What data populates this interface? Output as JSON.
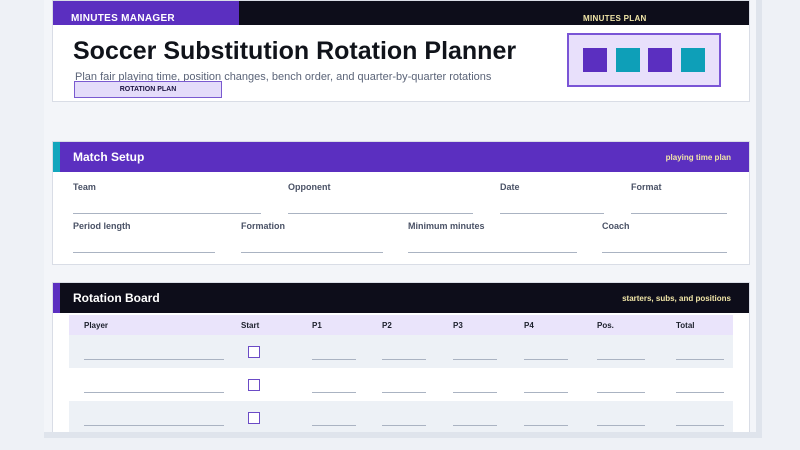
{
  "header": {
    "brand": "MINUTES MANAGER",
    "plan_tag": "MINUTES PLAN",
    "title": "Soccer Substitution Rotation Planner",
    "subtitle": "Plan fair playing time, position changes, bench order, and quarter-by-quarter rotations",
    "badge": "ROTATION PLAN",
    "swatch_colors": [
      "#5b2fc0",
      "#0e9fb8",
      "#5b2fc0",
      "#0e9fb8"
    ]
  },
  "setup": {
    "title": "Match Setup",
    "note": "playing time plan",
    "fields_row1": [
      "Team",
      "Opponent",
      "Date",
      "Format"
    ],
    "fields_row2": [
      "Period length",
      "Formation",
      "Minimum minutes",
      "Coach"
    ]
  },
  "board": {
    "title": "Rotation Board",
    "note": "starters, subs, and positions",
    "columns": [
      "Player",
      "Start",
      "P1",
      "P2",
      "P3",
      "P4",
      "Pos.",
      "Total"
    ]
  },
  "colors": {
    "purple": "#5b2fc0",
    "teal": "#13a6bd",
    "dark": "#0d0d1a",
    "accent_text": "#f1e6a8"
  }
}
